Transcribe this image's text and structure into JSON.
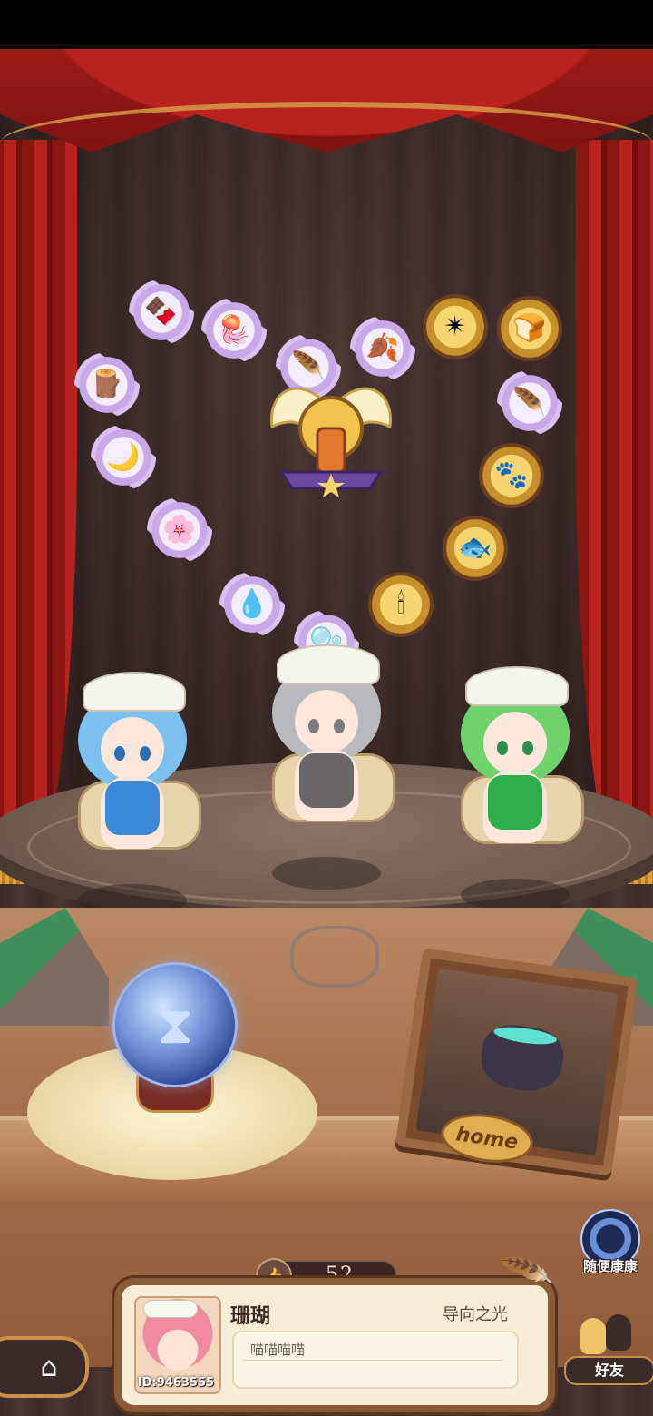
{
  "player": {
    "name": "珊瑚",
    "title": "导向之光",
    "id_text": "ID:9463555",
    "message": "喵喵喵喵"
  },
  "likes": {
    "count": "52"
  },
  "buttons": {
    "random_visit_label": "随便康康",
    "friends_label": "好友",
    "home_plaque_label": "home"
  },
  "icons": {
    "home": "home-icon",
    "hourglass": "hourglass-icon",
    "thumbs_up": "thumbs-up-icon",
    "feather": "quill-icon",
    "random_visit": "vortex-icon",
    "friends": "friends-icon"
  },
  "colors": {
    "curtain": "#b8241d",
    "gold": "#d9a24a",
    "card_border": "#8b5a36",
    "orb": "#6e8fd8"
  }
}
